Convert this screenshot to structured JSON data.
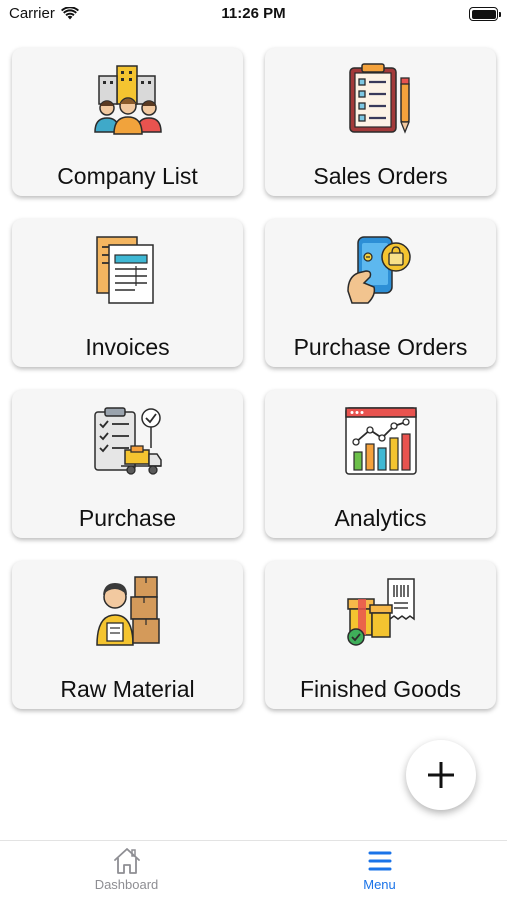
{
  "status_bar": {
    "carrier": "Carrier",
    "time": "11:26 PM"
  },
  "tiles": [
    {
      "label": "Company List",
      "icon": "company-people-icon"
    },
    {
      "label": "Sales Orders",
      "icon": "clipboard-checklist-icon"
    },
    {
      "label": "Invoices",
      "icon": "invoice-documents-icon"
    },
    {
      "label": "Purchase Orders",
      "icon": "mobile-shopping-icon"
    },
    {
      "label": "Purchase",
      "icon": "checklist-delivery-icon"
    },
    {
      "label": "Analytics",
      "icon": "analytics-chart-icon"
    },
    {
      "label": "Raw Material",
      "icon": "worker-boxes-icon"
    },
    {
      "label": "Finished Goods",
      "icon": "packages-receipt-icon"
    }
  ],
  "fab": {
    "icon": "plus-icon"
  },
  "tab_bar": {
    "items": [
      {
        "label": "Dashboard",
        "icon": "home-icon",
        "active": false
      },
      {
        "label": "Menu",
        "icon": "hamburger-icon",
        "active": true
      }
    ],
    "active_color": "#1a73e8",
    "inactive_color": "#8e8e93"
  }
}
